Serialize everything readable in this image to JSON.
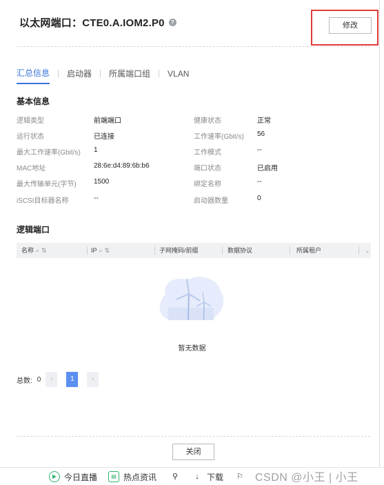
{
  "dialog": {
    "title": "以太网端口：CTE0.A.IOM2.P0",
    "help_icon": "?",
    "modify_label": "修改",
    "close_label": "关闭"
  },
  "tabs": [
    {
      "label": "汇总信息",
      "active": true
    },
    {
      "label": "启动器",
      "active": false
    },
    {
      "label": "所属端口组",
      "active": false
    },
    {
      "label": "VLAN",
      "active": false
    }
  ],
  "basic_info": {
    "section_title": "基本信息",
    "left": [
      {
        "label": "逻辑类型",
        "value": "前端端口"
      },
      {
        "label": "运行状态",
        "value": "已连接"
      },
      {
        "label": "最大工作速率(Gbit/s)",
        "value": "1"
      },
      {
        "label": "MAC地址",
        "value": "28:6e:d4:89:6b:b6"
      },
      {
        "label": "最大传输单元(字节)",
        "value": "1500"
      },
      {
        "label": "iSCSI目标器名称",
        "value": "--"
      }
    ],
    "right": [
      {
        "label": "健康状态",
        "value": "正常"
      },
      {
        "label": "工作速率(Gbit/s)",
        "value": "56"
      },
      {
        "label": "工作模式",
        "value": "--"
      },
      {
        "label": "端口状态",
        "value": "已启用"
      },
      {
        "label": "绑定名称",
        "value": "--"
      },
      {
        "label": "启动器数量",
        "value": "0"
      }
    ]
  },
  "logical_ports": {
    "section_title": "逻辑端口",
    "columns": [
      "名称",
      "IP",
      "子网掩码/前缀",
      "数据协议",
      "所属租户"
    ],
    "empty_text": "暂无数据"
  },
  "pagination": {
    "total_label": "总数:",
    "total": "0",
    "prev": "‹",
    "current_page": "1",
    "next": "›"
  },
  "taskbar": {
    "items": [
      "今日直播",
      "热点资讯",
      "下载"
    ],
    "watermark": "CSDN @小王 | 小王"
  },
  "colors": {
    "accent": "#3873d9",
    "highlight_box": "#e03b3b",
    "page_current": "#5b8ff0"
  }
}
